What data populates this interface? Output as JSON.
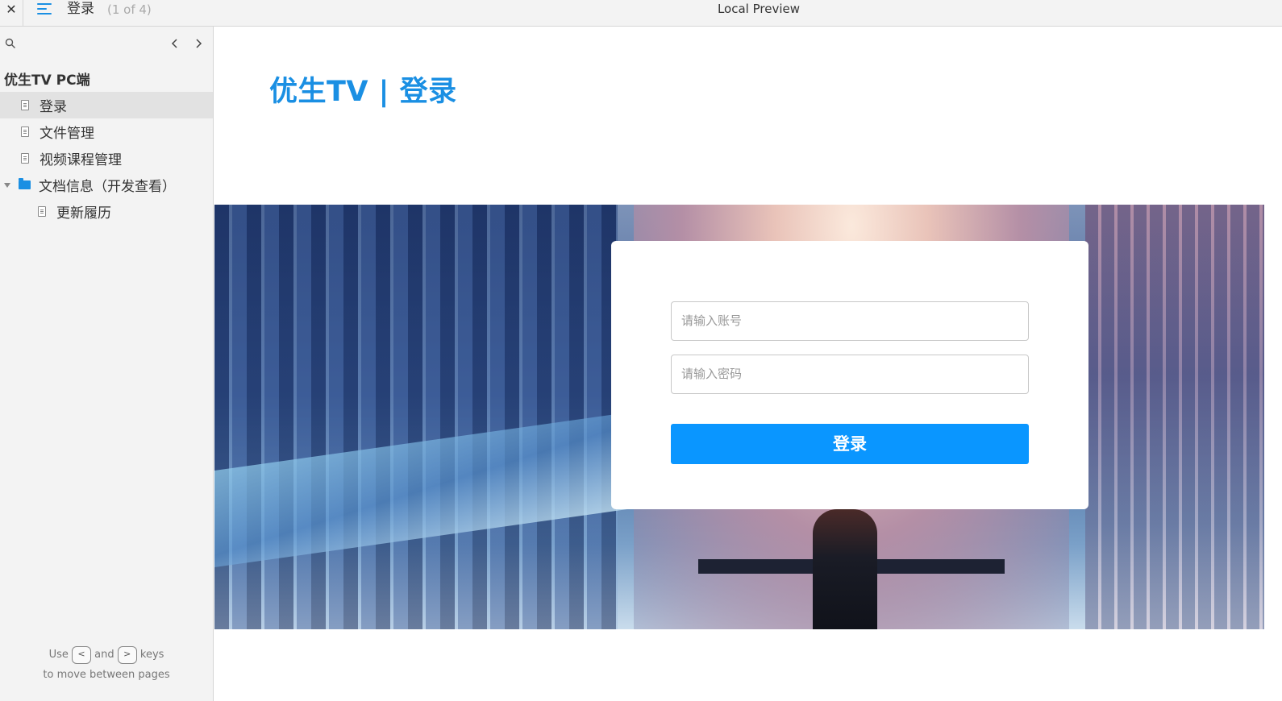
{
  "topbar": {
    "close_glyph": "✕",
    "page_title": "登录",
    "page_count": "(1 of 4)",
    "window_title": "Local Preview"
  },
  "sidebar": {
    "project_title": "优生TV PC端",
    "items": [
      {
        "label": "登录",
        "type": "page",
        "active": true
      },
      {
        "label": "文件管理",
        "type": "page"
      },
      {
        "label": "视频课程管理",
        "type": "page"
      },
      {
        "label": "文档信息（开发查看）",
        "type": "folder",
        "expanded": true
      },
      {
        "label": "更新履历",
        "type": "page",
        "indent": 1
      }
    ],
    "help": {
      "use": "Use",
      "key_prev": "<",
      "and": "and",
      "key_next": ">",
      "keys": "keys",
      "line2": "to move between pages"
    }
  },
  "main": {
    "heading": "优生TV | 登录",
    "login": {
      "account_placeholder": "请输入账号",
      "password_placeholder": "请输入密码",
      "submit_label": "登录"
    }
  },
  "colors": {
    "accent": "#1a8fe3",
    "button": "#0a96ff",
    "sidebar_bg": "#f3f3f3"
  }
}
